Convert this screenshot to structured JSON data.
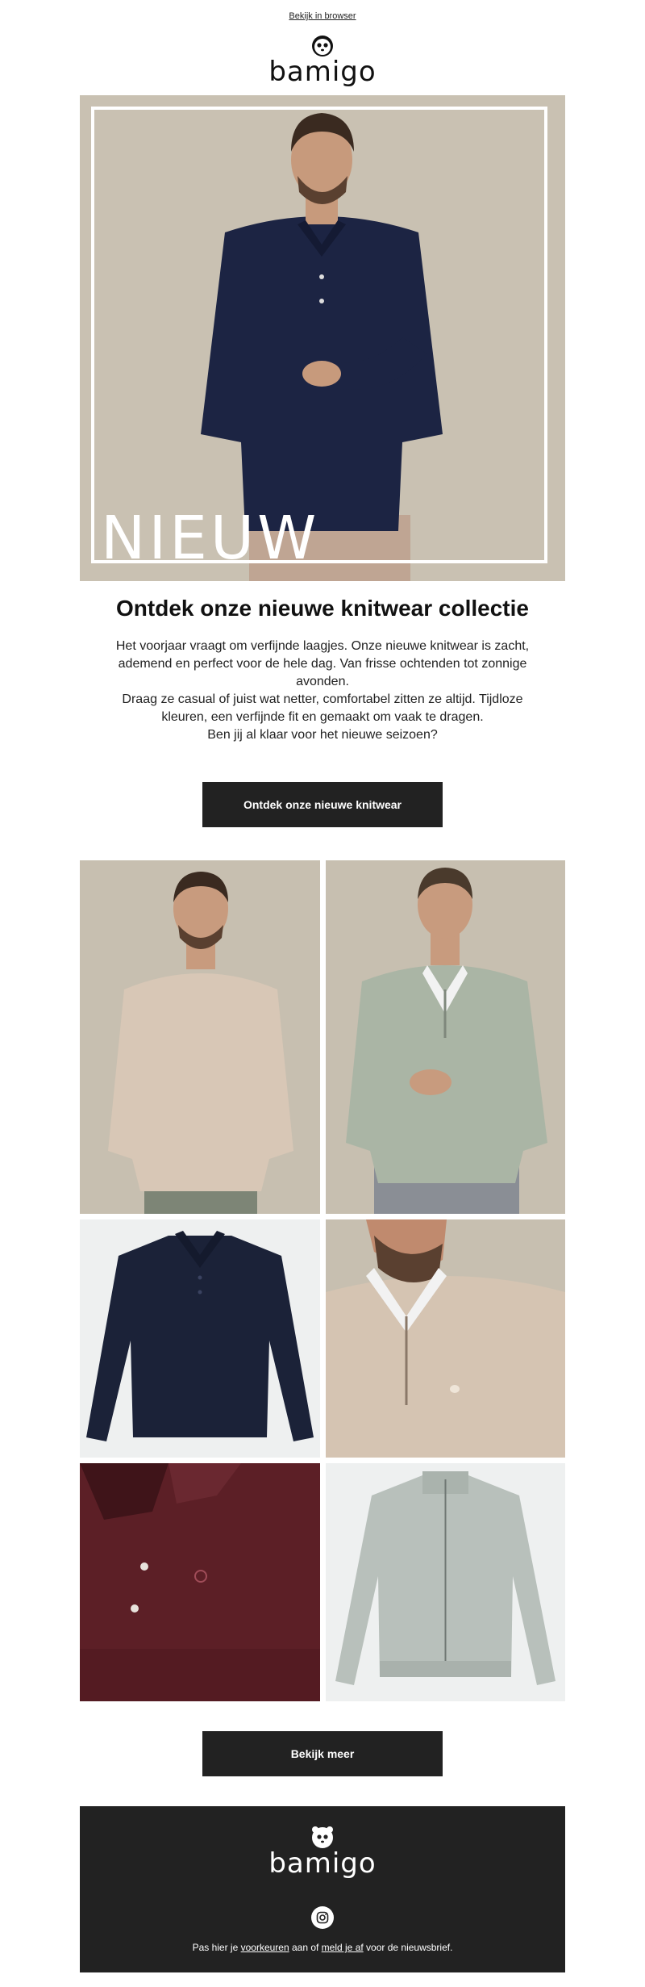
{
  "header": {
    "browser_link": "Bekijk in browser",
    "logo_text": "bamigo"
  },
  "hero": {
    "overlay_text": "NIEUW"
  },
  "main": {
    "headline": "Ontdek onze nieuwe knitwear collectie",
    "paragraph_1": "Het voorjaar vraagt om verfijnde laagjes. Onze nieuwe knitwear is zacht, ademend en perfect voor de hele dag. Van frisse ochtenden tot zonnige avonden.",
    "paragraph_2": "Draag ze casual of juist wat netter, comfortabel zitten ze altijd. Tijdloze kleuren, een verfijnde fit en gemaakt om vaak te dragen.",
    "paragraph_3": "Ben jij al klaar voor het nieuwe seizoen?",
    "cta_label": "Ontdek onze nieuwe knitwear"
  },
  "grid": {
    "tiles": [
      {
        "name": "beige polo on model",
        "bg": "#c7bfb0",
        "garment": "#d8c7b6"
      },
      {
        "name": "sage zip sweater on model",
        "bg": "#c7bfb0",
        "garment": "#aab5a5"
      },
      {
        "name": "navy polo flat",
        "bg": "#eef0f0",
        "garment": "#1b2238"
      },
      {
        "name": "beige zip sweater close-up",
        "bg": "#c7bfb0",
        "garment": "#d5c4b2"
      },
      {
        "name": "burgundy polo close-up",
        "bg": "#3a1c20",
        "garment": "#5c1f26"
      },
      {
        "name": "grey zip cardigan flat",
        "bg": "#eef0f0",
        "garment": "#b8c0bb"
      }
    ],
    "more_label": "Bekijk meer"
  },
  "footer": {
    "logo_text": "bamigo",
    "instagram_icon": "instagram-icon",
    "text_before": "Pas hier je ",
    "link_preferences": "voorkeuren",
    "text_middle": " aan of ",
    "link_unsubscribe": "meld je af",
    "text_after": " voor de nieuwsbrief."
  },
  "colors": {
    "button_bg": "#222222",
    "footer_bg": "#222222",
    "hero_bg": "#c9c1b2"
  }
}
